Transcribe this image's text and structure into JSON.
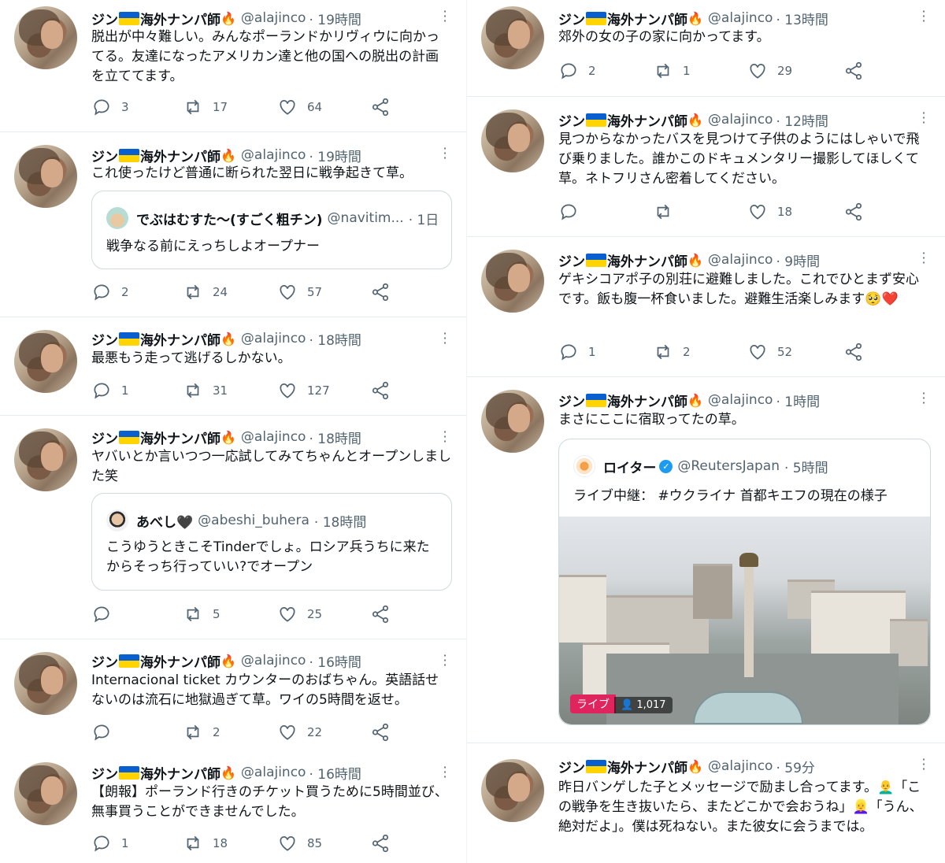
{
  "user": {
    "name": "ジン",
    "name_suffix": "海外ナンパ師",
    "handle": "@alajinco"
  },
  "left_tweets": [
    {
      "time": "· 19時間",
      "text": "脱出が中々難しい。みんなポーランドかリヴィウに向かってる。友達になったアメリカン達と他の国への脱出の計画を立ててます。",
      "replies": "3",
      "retweets": "17",
      "likes": "64"
    },
    {
      "time": "· 19時間",
      "text": "これ使ったけど普通に断られた翌日に戦争起きて草。",
      "quote": {
        "name": "でぶはむすた〜(すごく粗チン)",
        "handle": "@navitim...",
        "time": "· 1日",
        "text": "戦争なる前にえっちしよオープナー"
      },
      "replies": "2",
      "retweets": "24",
      "likes": "57"
    },
    {
      "time": "· 18時間",
      "text": "最悪もう走って逃げるしかない。",
      "replies": "1",
      "retweets": "31",
      "likes": "127"
    },
    {
      "time": "· 18時間",
      "text": "ヤバいとか言いつつ一応試してみてちゃんとオープンしました笑",
      "quote": {
        "name": "あべし🖤",
        "handle": "@abeshi_buhera",
        "time": "· 18時間",
        "text": "こうゆうときこそTinderでしょ。ロシア兵うちに来たからそっち行っていい?でオープン"
      },
      "replies": "",
      "retweets": "5",
      "likes": "25"
    },
    {
      "time": "· 16時間",
      "text": "Internacional ticket カウンターのおばちゃん。英語話せないのは流石に地獄過ぎて草。ワイの5時間を返せ。",
      "replies": "",
      "retweets": "2",
      "likes": "22"
    },
    {
      "time": "· 16時間",
      "text": "【朗報】ポーランド行きのチケット買うために5時間並び、無事買うことができませんでした。",
      "replies": "1",
      "retweets": "18",
      "likes": "85"
    }
  ],
  "right_tweets": [
    {
      "time": "· 13時間",
      "text": "郊外の女の子の家に向かってます。",
      "replies": "2",
      "retweets": "1",
      "likes": "29"
    },
    {
      "time": "· 12時間",
      "text": "見つからなかったバスを見つけて子供のようにはしゃいで飛び乗りました。誰かこのドキュメンタリー撮影してほしくて草。ネトフリさん密着してください。",
      "replies": "",
      "retweets": "",
      "likes": "18"
    },
    {
      "time": "· 9時間",
      "text": "ゲキシコアポ子の別荘に避難しました。これでひとまず安心です。飯も腹一杯食いました。避難生活楽しみます🥺❤️",
      "replies": "1",
      "retweets": "2",
      "likes": "52"
    },
    {
      "time": "· 1時間",
      "text": "まさにここに宿取ってたの草。",
      "quote": {
        "name": "ロイター",
        "handle": "@ReutersJapan",
        "time": "· 5時間",
        "text": "ライブ中継： #ウクライナ 首都キエフの現在の様子",
        "media_badge": "ライブ",
        "media_viewers": "1,017"
      }
    },
    {
      "time": "· 59分",
      "text": "昨日バンゲした子とメッセージで励まし合ってます。👨‍🦲「この戦争を生き抜いたら、またどこかで会おうね」👱‍♀️「うん、絶対だよ」。僕は死ねない。また彼女に会うまでは。"
    }
  ],
  "colors": {
    "text": "#0f1419",
    "secondary": "#536471",
    "border": "#e6ecf0",
    "flag_blue": "#0a5fd0",
    "flag_yellow": "#ffd400",
    "live_red": "#e0245e",
    "verified_blue": "#1d9bf0"
  }
}
